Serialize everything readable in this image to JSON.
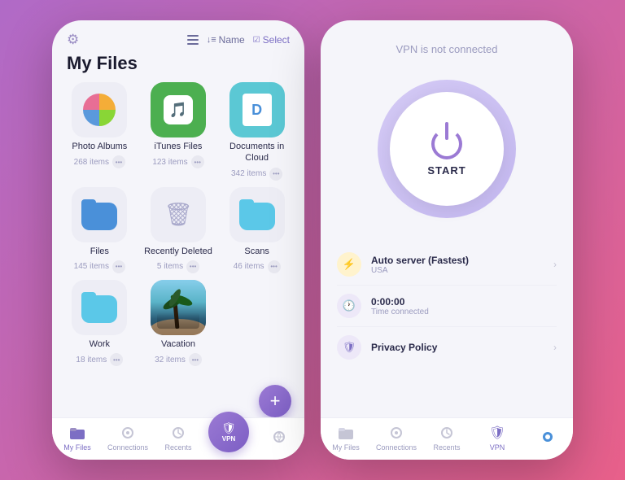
{
  "background": "linear-gradient(135deg, #b06ac7 0%, #e8608a 100%)",
  "left_phone": {
    "title": "My Files",
    "sort_label": "Name",
    "select_label": "Select",
    "files": [
      {
        "id": "photo-albums",
        "name": "Photo Albums",
        "count": "268 items",
        "type": "photo"
      },
      {
        "id": "itunes-files",
        "name": "iTunes Files",
        "count": "123 items",
        "type": "itunes"
      },
      {
        "id": "documents-cloud",
        "name": "Documents in Cloud",
        "count": "342 items",
        "type": "docs"
      },
      {
        "id": "files",
        "name": "Files",
        "count": "145 items",
        "type": "folder-blue"
      },
      {
        "id": "recently-deleted",
        "name": "Recently Deleted",
        "count": "5 items",
        "type": "trash"
      },
      {
        "id": "scans",
        "name": "Scans",
        "count": "46 items",
        "type": "folder-teal"
      },
      {
        "id": "work",
        "name": "Work",
        "count": "18 items",
        "type": "folder-blue2"
      },
      {
        "id": "vacation",
        "name": "Vacation",
        "count": "32 items",
        "type": "photo-vacation"
      }
    ],
    "nav": {
      "items": [
        {
          "id": "my-files",
          "label": "My Files",
          "active": true
        },
        {
          "id": "connections",
          "label": "Connections",
          "active": false
        },
        {
          "id": "recents",
          "label": "Recents",
          "active": false
        },
        {
          "id": "vpn",
          "label": "VPN",
          "active": false,
          "is_vpn": true
        },
        {
          "id": "browse",
          "label": "",
          "active": false
        }
      ]
    }
  },
  "right_phone": {
    "status": "VPN is not connected",
    "start_label": "START",
    "server": {
      "title": "Auto server (Fastest)",
      "sub": "USA"
    },
    "time": {
      "title": "0:00:00",
      "sub": "Time connected"
    },
    "policy": {
      "title": "Privacy Policy"
    },
    "nav": {
      "items": [
        {
          "id": "my-files",
          "label": "My Files",
          "active": false
        },
        {
          "id": "connections",
          "label": "Connections",
          "active": false
        },
        {
          "id": "recents",
          "label": "Recents",
          "active": false
        },
        {
          "id": "vpn",
          "label": "VPN",
          "active": true
        },
        {
          "id": "browse",
          "label": "",
          "active": false
        }
      ]
    }
  }
}
